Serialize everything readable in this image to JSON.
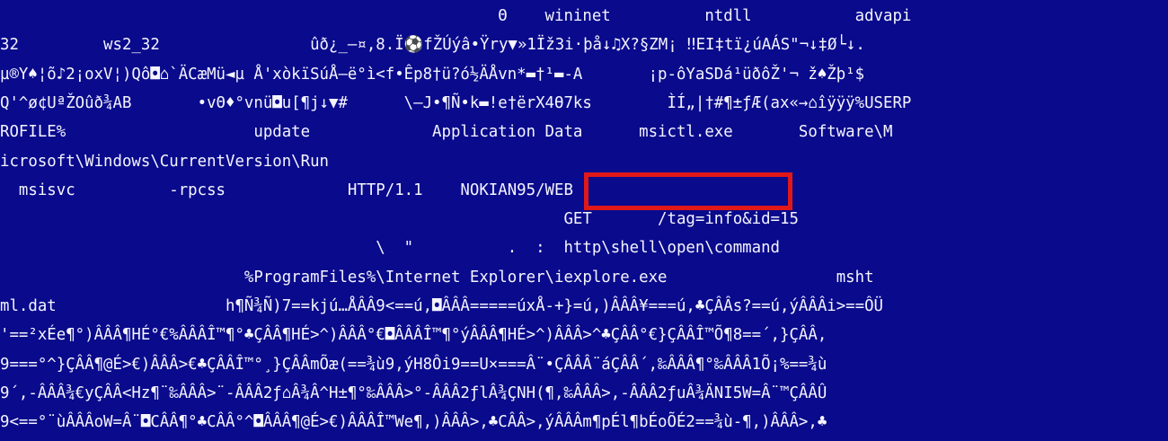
{
  "hex_dump": {
    "lines": [
      "                                                     Θ    wininet          ntdll           advapi",
      "32         ws2_32                ûð¿_—¤,8.Ï⚽fŽÚýâ•Ÿry▼»1Ïž3i·þå↓♫X?§ZM¡ ‼EI‡tï¿úAÁS\"¬↓‡Ø└↓.",
      "µ®Y♠¦õ♪2¡oxV¦)Qô◘⌂`ÄCæMü◄µ Å'xòkïSúÅ–ë°ì<f•Êp8†ü?ó½ÄÅvn*▬†¹▬-A       ¡p-ôYaSDá¹üðôŽ'¬ ž♠Žþ¹$",
      "Q'^ø¢UªŽOûð¾AB       •vΘ♦°vnü◘u[¶j↓▼#      \\—J•¶Ñ•k▬!e†ërX4Ө7ks        ÌÍ„|†#¶±ƒÆ(ax«→⌂îÿÿÿ%USERP",
      "ROFILE%                    update             Application Data      msictl.exe       Software\\M",
      "icrosoft\\Windows\\CurrentVersion\\Run",
      "  msisvc          -rpcss             HTTP/1.1    NOKIAN95/WEB",
      "                                                            GET       /tag=info&id=15",
      "                                        \\  \"          .  :  http\\shell\\open\\command",
      "                          %ProgramFiles%\\Internet Explorer\\iexplore.exe                  msht",
      "ml.dat                  h¶Ñ¾Ñ)7==kjú…ÅÂÂ9<==ú,◘ÂÂÂ=====úxÅ-+}=ú,)ÂÂÂ¥===ú,♣ÇÂÂs?==ú,ýÂÂÂi>==ÔÜ",
      "'==²xÉe¶°)ÂÂÂ¶HÉ°€%ÂÂÂÎ™¶°♣ÇÂÂ¶HÉ>^)ÂÂÂ°€◘ÂÂÂÎ™¶°ýÂÂÂ¶HÉ>^)ÂÂÂ>^♣ÇÂÂ°€}ÇÂÂÎ™Õ¶8==´,}ÇÂÂ,",
      "9===°^}ÇÂÂ¶@É>€)ÂÂÂ>€♣ÇÂÂÎ™°¸}ÇÂÂmÕæ(==¾ù9,ýH8Ôi9==U×===Â¨•ÇÂÂÂ¨áÇÂÂ´,‰ÂÂÂ¶°‰ÂÂÂ1Õ¡%==¾ù",
      "9´,-ÂÂÂ¾€yÇÂÂ<Hz¶¨‰ÂÂÂ>¨-ÂÂÂ2ƒ⌂Â¾Â^H±¶°‰ÂÂÂ>°-ÂÂÂ2ƒlÂ¾ÇNH(¶,‰ÂÂÂ>,-ÂÂÂ2ƒuÂ¾ÄNI5W=Â¨™ÇÂÂÛ",
      "9<==°¨ùÂÂÂoW=Â¨◘CÂÂ¶°♣CÂÂ°^◘ÂÂÂ¶@É>€)ÂÂÂÎ™We¶,)ÂÂÂ>,♣CÂÂ>,ýÂÂÂm¶pÉl¶bÉoÕÉ2==¾ù-¶,)ÂÂÂ>,♣"
    ]
  },
  "highlight": {
    "text": "NOKIAN95/WEB",
    "color": "#e01818"
  },
  "colors": {
    "background": "#0a0a8c",
    "text": "#f4f4ff"
  }
}
